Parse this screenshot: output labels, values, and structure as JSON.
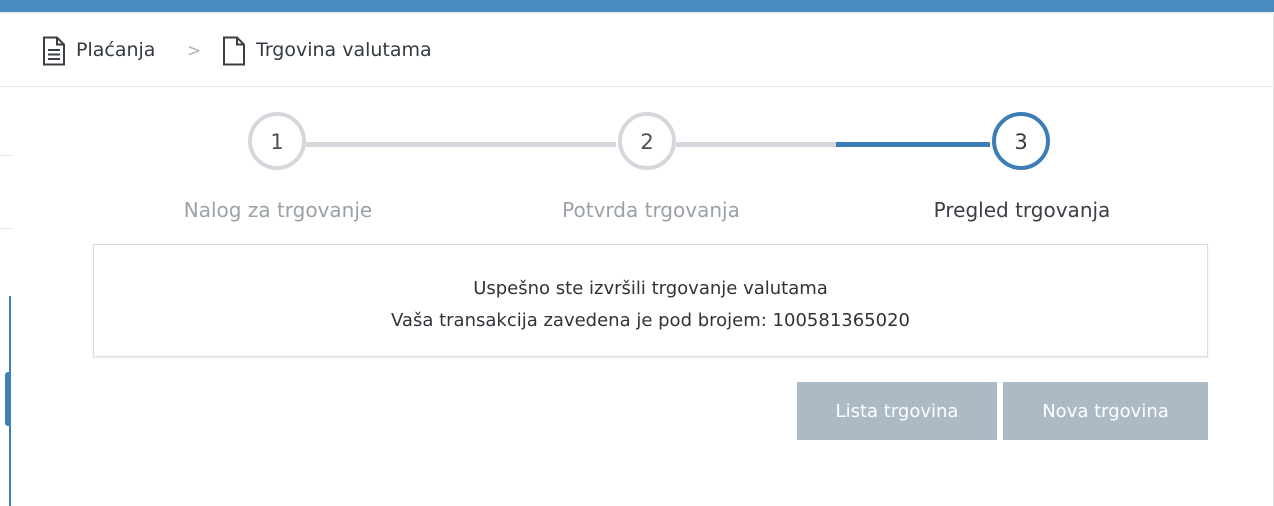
{
  "breadcrumb": {
    "items": [
      {
        "label": "Plaćanja",
        "icon": "document-lines-icon"
      },
      {
        "label": "Trgovina valutama",
        "icon": "document-blank-icon"
      }
    ],
    "separator": ">"
  },
  "stepper": {
    "steps": [
      {
        "number": "1",
        "label": "Nalog za trgovanje",
        "state": "inactive"
      },
      {
        "number": "2",
        "label": "Potvrda trgovanja",
        "state": "inactive"
      },
      {
        "number": "3",
        "label": "Pregled trgovanja",
        "state": "active"
      }
    ],
    "colors": {
      "active": "#3d7db4",
      "inactive": "#d4d8dc"
    }
  },
  "message": {
    "line1": "Uspešno ste izvršili trgovanje valutama",
    "line2": "Vaša transakcija zavedena je pod brojem: 100581365020"
  },
  "actions": {
    "list_label": "Lista trgovina",
    "new_label": "Nova trgovina"
  },
  "theme": {
    "accent": "#4a8bbf",
    "button_bg": "#abbac4"
  }
}
